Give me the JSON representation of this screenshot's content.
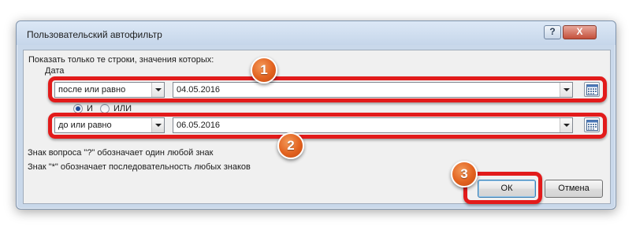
{
  "dialog": {
    "title": "Пользовательский автофильтр",
    "help_label": "?",
    "close_label": "X"
  },
  "filter": {
    "instruction": "Показать только те строки, значения которых:",
    "column_name": "Дата",
    "condition1": {
      "operator": "после или равно",
      "value": "04.05.2016"
    },
    "logic": {
      "and_label": "И",
      "or_label": "ИЛИ",
      "selected": "И"
    },
    "condition2": {
      "operator": "до или равно",
      "value": "06.05.2016"
    }
  },
  "hints": {
    "question_mark": "Знак вопроса \"?\" обозначает один любой знак",
    "asterisk": "Знак \"*\" обозначает последовательность любых знаков"
  },
  "buttons": {
    "ok": "ОК",
    "cancel": "Отмена"
  },
  "annotations": {
    "badge1": "1",
    "badge2": "2",
    "badge3": "3",
    "highlight_color": "#e21b1b",
    "badge_color": "#e2621f"
  },
  "icons": [
    "help-icon",
    "close-icon",
    "dropdown-arrow-icon",
    "calendar-icon",
    "radio-icon"
  ]
}
